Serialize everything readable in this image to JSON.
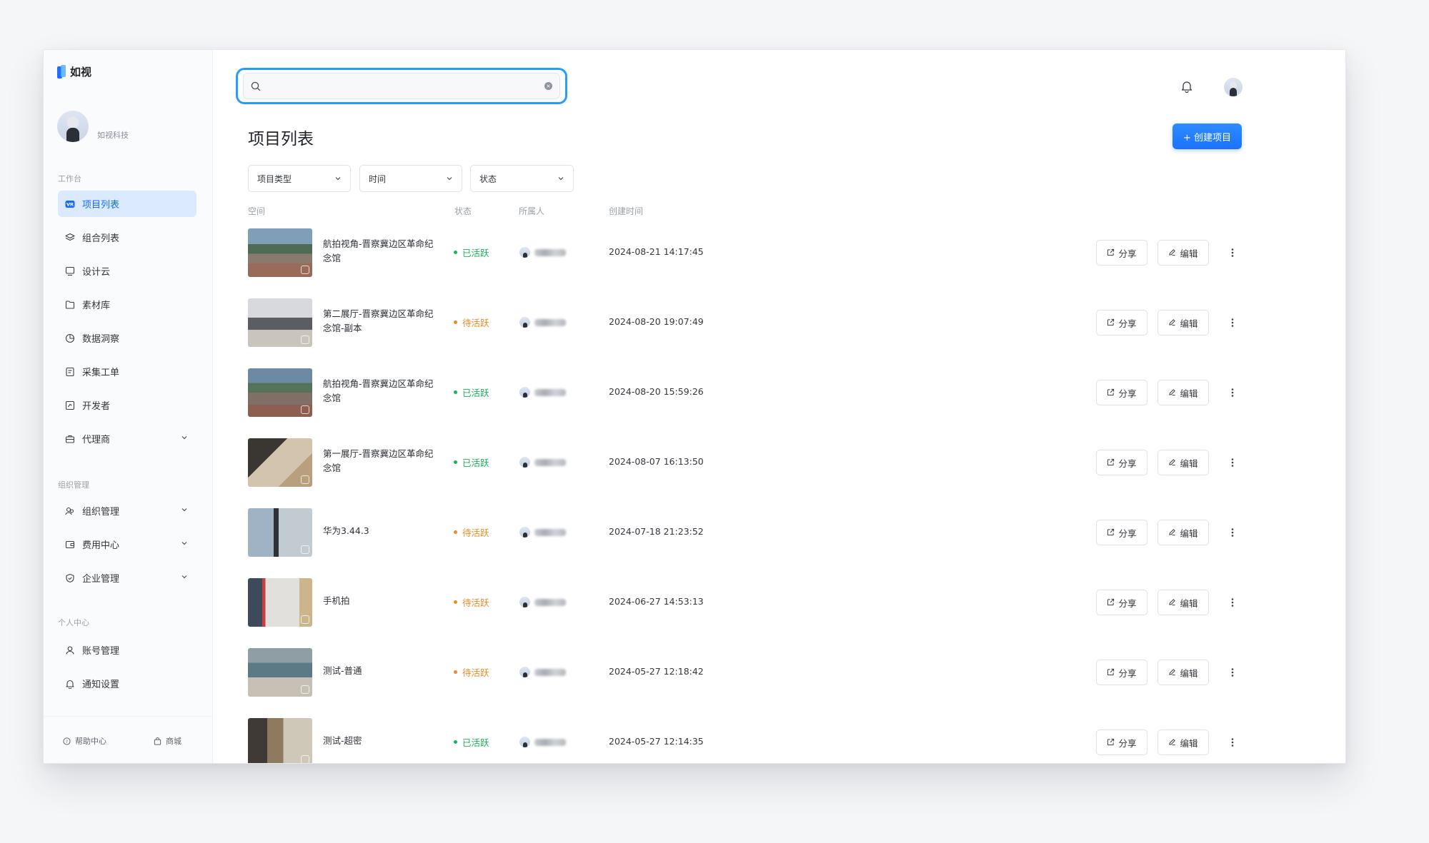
{
  "brand": {
    "name": "如视"
  },
  "profile": {
    "name": "如视科技"
  },
  "sidebar": {
    "sections": [
      {
        "label": "工作台"
      },
      {
        "label": "组织管理"
      },
      {
        "label": "个人中心"
      }
    ],
    "items": [
      {
        "label": "项目列表",
        "icon": "vr-icon",
        "active": true
      },
      {
        "label": "组合列表",
        "icon": "layers-icon"
      },
      {
        "label": "设计云",
        "icon": "monitor-icon"
      },
      {
        "label": "素材库",
        "icon": "folder-icon"
      },
      {
        "label": "数据洞察",
        "icon": "chart-pie-icon"
      },
      {
        "label": "采集工单",
        "icon": "form-icon"
      },
      {
        "label": "开发者",
        "icon": "code-icon"
      },
      {
        "label": "代理商",
        "icon": "briefcase-icon",
        "expandable": true
      },
      {
        "label": "组织管理",
        "icon": "org-icon",
        "expandable": true
      },
      {
        "label": "费用中心",
        "icon": "wallet-icon",
        "expandable": true
      },
      {
        "label": "企业管理",
        "icon": "shield-icon",
        "expandable": true
      },
      {
        "label": "账号管理",
        "icon": "user-icon"
      },
      {
        "label": "通知设置",
        "icon": "bell-icon"
      }
    ],
    "footer": {
      "help": "帮助中心",
      "shop": "商城"
    }
  },
  "search": {
    "value": "",
    "placeholder": ""
  },
  "main": {
    "title": "项目列表",
    "create_button": "+ 创建项目",
    "filters": [
      "项目类型",
      "时间",
      "状态"
    ],
    "columns": [
      "空间",
      "状态",
      "所属人",
      "创建时间"
    ],
    "actions": {
      "share": "分享",
      "edit": "编辑"
    }
  },
  "status_colors": {
    "已活跃": "#19b35a",
    "待活跃": "#f08a24"
  },
  "rows": [
    {
      "name": "航拍视角-晋察冀边区革命纪念馆",
      "status": "已活跃",
      "time": "2024-08-21 14:17:45"
    },
    {
      "name": "第二展厅-晋察冀边区革命纪念馆-副本",
      "status": "待活跃",
      "time": "2024-08-20 19:07:49"
    },
    {
      "name": "航拍视角-晋察冀边区革命纪念馆",
      "status": "已活跃",
      "time": "2024-08-20 15:59:26"
    },
    {
      "name": "第一展厅-晋察冀边区革命纪念馆",
      "status": "已活跃",
      "time": "2024-08-07 16:13:50"
    },
    {
      "name": "华为3.44.3",
      "status": "待活跃",
      "time": "2024-07-18 21:23:52"
    },
    {
      "name": "手机拍",
      "status": "待活跃",
      "time": "2024-06-27 14:53:13"
    },
    {
      "name": "测试-普通",
      "status": "待活跃",
      "time": "2024-05-27 12:18:42"
    },
    {
      "name": "测试-超密",
      "status": "已活跃",
      "time": "2024-05-27 12:14:35"
    }
  ]
}
